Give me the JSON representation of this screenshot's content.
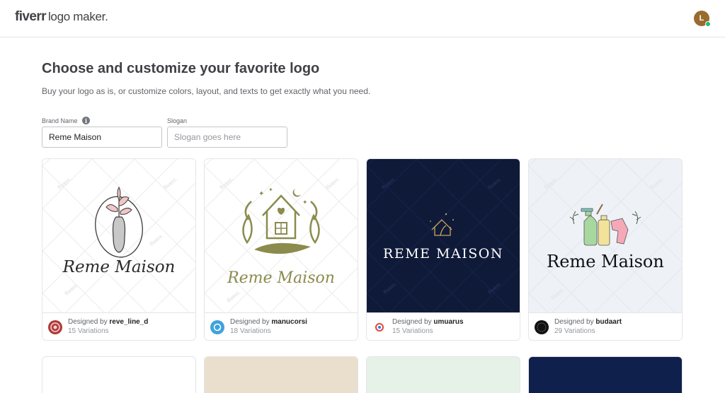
{
  "header": {
    "brand_bold": "fiverr",
    "brand_rest": "logo maker.",
    "avatar_initial": "L"
  },
  "intro": {
    "title": "Choose and customize your favorite logo",
    "subtitle": "Buy your logo as is, or customize colors, layout, and texts to get exactly what you need."
  },
  "form": {
    "brand_label": "Brand Name",
    "brand_value": "Reme Maison",
    "slogan_label": "Slogan",
    "slogan_placeholder": "Slogan goes here"
  },
  "watermark_text": "fiverr.",
  "cards": [
    {
      "logo_text": "Reme Maison",
      "designed_by": "Designed by",
      "designer": "reve_line_d",
      "variations": "15 Variations",
      "bg": "#ffffff"
    },
    {
      "logo_text": "Reme Maison",
      "designed_by": "Designed by",
      "designer": "manucorsi",
      "variations": "18 Variations",
      "bg": "#ffffff"
    },
    {
      "logo_text": "REME MAISON",
      "designed_by": "Designed by",
      "designer": "umuarus",
      "variations": "15 Variations",
      "bg": "#0f1a38"
    },
    {
      "logo_text": "Reme Maison",
      "designed_by": "Designed by",
      "designer": "budaart",
      "variations": "29 Variations",
      "bg": "#eef2f7"
    }
  ],
  "partial_cards_bg": [
    "#ffffff",
    "#eadfcd",
    "#e6f2e8",
    "#10204d"
  ],
  "colors": {
    "accent_green": "#1dbf73",
    "olive": "#8b8b4e",
    "navy": "#0f1a38",
    "gold": "#c9a55a"
  }
}
